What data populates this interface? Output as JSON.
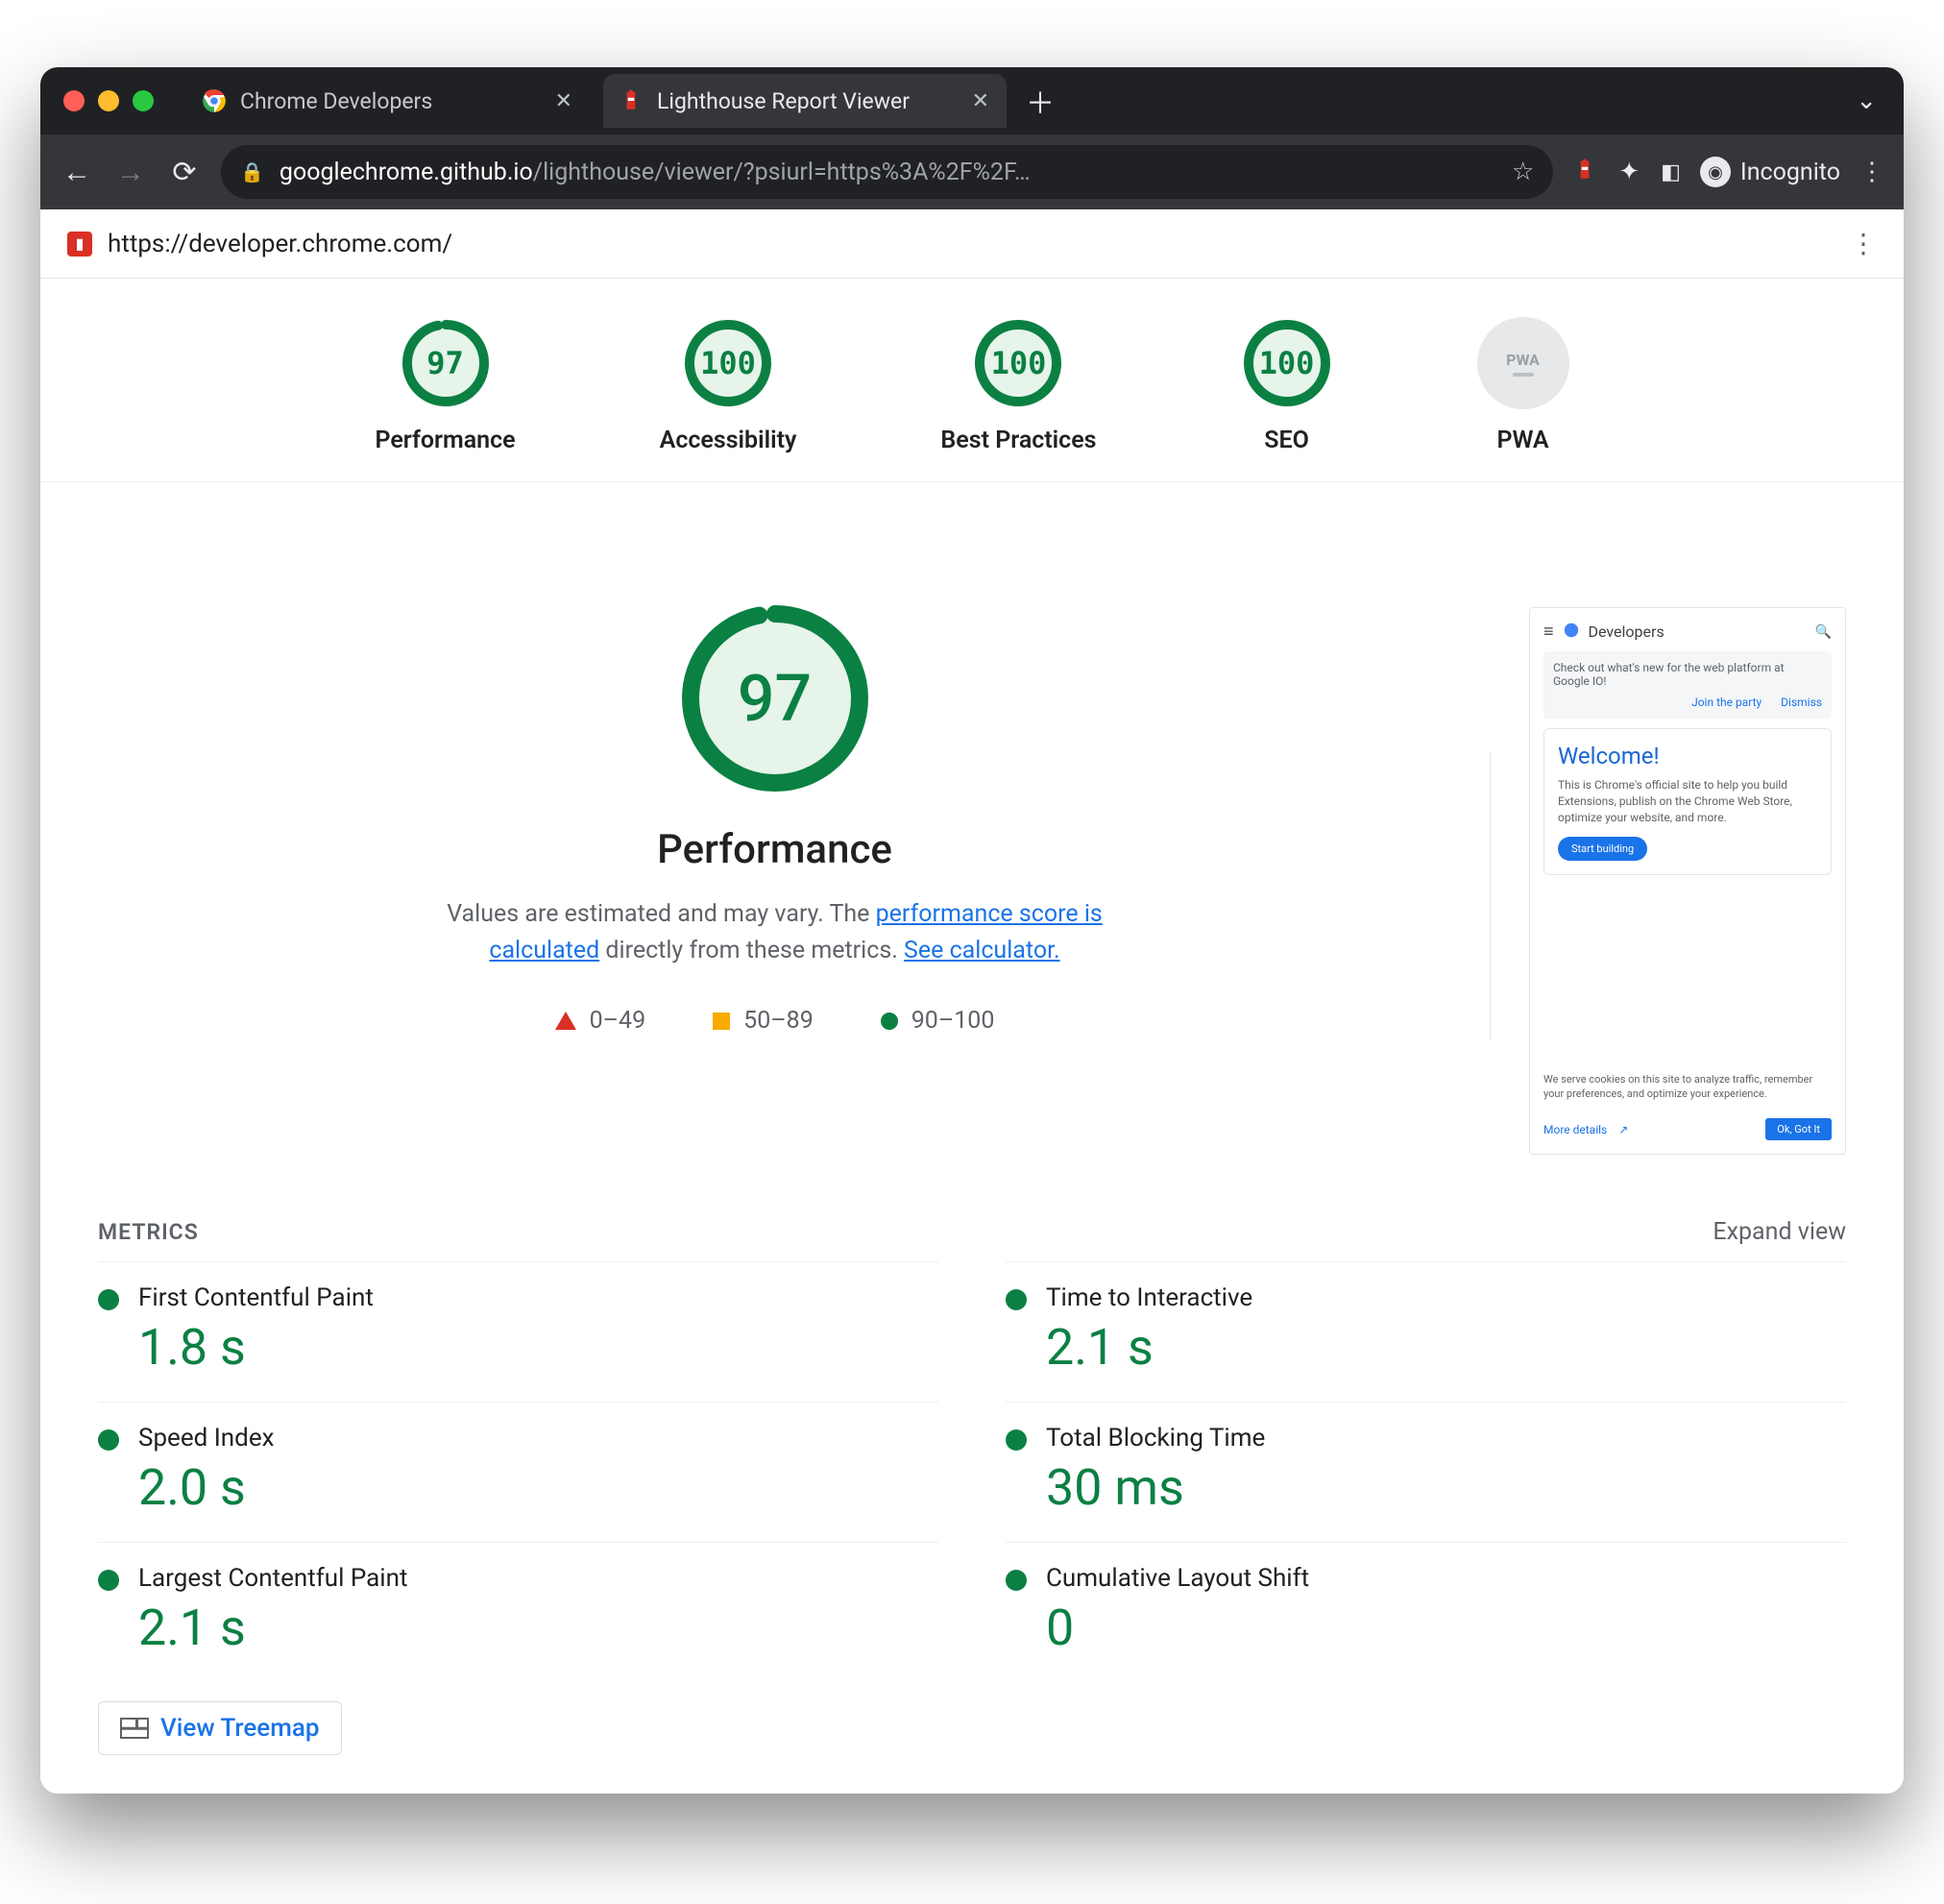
{
  "browser": {
    "tabs": [
      {
        "title": "Chrome Developers",
        "active": false
      },
      {
        "title": "Lighthouse Report Viewer",
        "active": true
      }
    ],
    "url_host": "googlechrome.github.io",
    "url_path": "/lighthouse/viewer/?psiurl=https%3A%2F%2F…",
    "incognito_label": "Incognito"
  },
  "subheader": {
    "url": "https://developer.chrome.com/"
  },
  "gauges": [
    {
      "label": "Performance",
      "score": 97
    },
    {
      "label": "Accessibility",
      "score": 100
    },
    {
      "label": "Best Practices",
      "score": 100
    },
    {
      "label": "SEO",
      "score": 100
    },
    {
      "label": "PWA",
      "score": null
    }
  ],
  "performance": {
    "score": 97,
    "title": "Performance",
    "desc_prefix": "Values are estimated and may vary. The ",
    "link1": "performance score is calculated",
    "desc_mid": " directly from these metrics. ",
    "link2": "See calculator.",
    "legend": {
      "red": "0–49",
      "orange": "50–89",
      "green": "90–100"
    }
  },
  "screenshot": {
    "brand": "Developers",
    "banner_text": "Check out what's new for the web platform at Google IO!",
    "banner_join": "Join the party",
    "banner_dismiss": "Dismiss",
    "welcome_title": "Welcome!",
    "welcome_body": "This is Chrome's official site to help you build Extensions, publish on the Chrome Web Store, optimize your website, and more.",
    "welcome_cta": "Start building",
    "cookie_text": "We serve cookies on this site to analyze traffic, remember your preferences, and optimize your experience.",
    "cookie_details": "More details",
    "cookie_ok": "Ok, Got It"
  },
  "metrics": {
    "heading": "METRICS",
    "expand": "Expand view",
    "items": [
      {
        "name": "First Contentful Paint",
        "value": "1.8 s"
      },
      {
        "name": "Time to Interactive",
        "value": "2.1 s"
      },
      {
        "name": "Speed Index",
        "value": "2.0 s"
      },
      {
        "name": "Total Blocking Time",
        "value": "30 ms"
      },
      {
        "name": "Largest Contentful Paint",
        "value": "2.1 s"
      },
      {
        "name": "Cumulative Layout Shift",
        "value": "0"
      }
    ],
    "treemap": "View Treemap"
  }
}
